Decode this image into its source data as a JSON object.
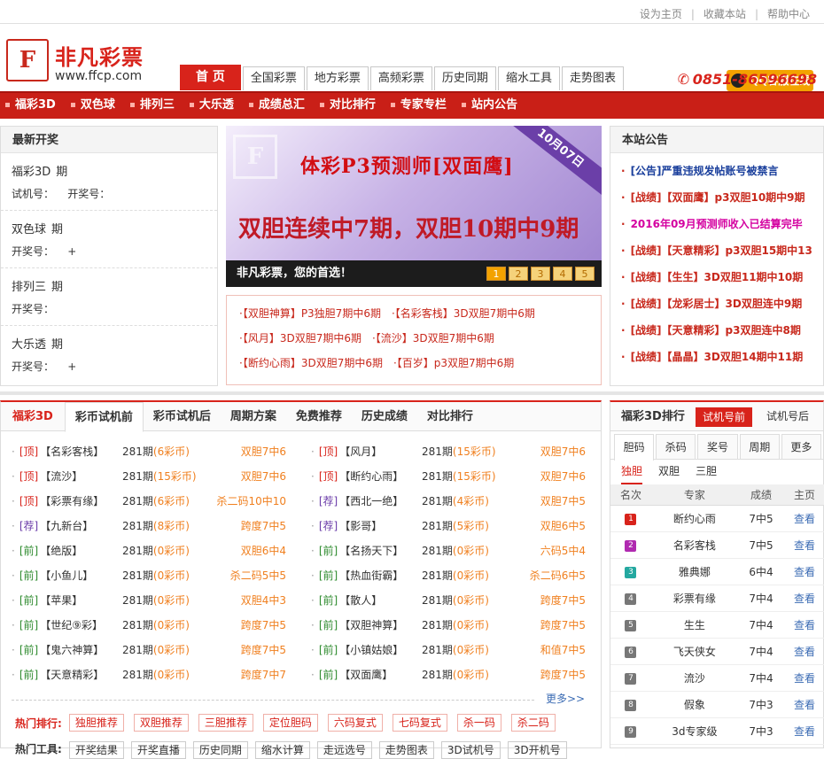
{
  "topbar": {
    "links": [
      "设为主页",
      "收藏本站",
      "帮助中心"
    ]
  },
  "header": {
    "logo_glyph": "F",
    "brand": "非凡彩票",
    "domain": "www.ffcp.com",
    "qq_label": "QQ客服在线",
    "phone": "0851-86596698",
    "tabs": [
      "首 页",
      "全国彩票",
      "地方彩票",
      "高频彩票",
      "历史同期",
      "缩水工具",
      "走势图表"
    ]
  },
  "nav": [
    "福彩3D",
    "双色球",
    "排列三",
    "大乐透",
    "成绩总汇",
    "对比排行",
    "专家专栏",
    "站内公告"
  ],
  "latest": {
    "title": "最新开奖",
    "items": [
      {
        "name": "福彩3D",
        "issue": "期",
        "r1": "试机号：    开奖号：",
        "r2": ""
      },
      {
        "name": "双色球",
        "issue": "期",
        "r1": "开奖号：    +",
        "r2": ""
      },
      {
        "name": "排列三",
        "issue": "期",
        "r1": "开奖号：",
        "r2": ""
      },
      {
        "name": "大乐透",
        "issue": "期",
        "r1": "开奖号：    +",
        "r2": ""
      }
    ]
  },
  "banner": {
    "logo": "F",
    "title": "体彩P3预测师[双面鹰]",
    "subtitle": "双胆连续中7期，双胆10期中9期",
    "corner": "10月07日",
    "caption": "非凡彩票，您的首选！",
    "pages": [
      "1",
      "2",
      "3",
      "4",
      "5"
    ]
  },
  "links": {
    "rows": [
      [
        "·【双胆神算】P3独胆7期中6期",
        "·【名彩客栈】3D双胆7期中6期"
      ],
      [
        "·【风月】3D双胆7期中6期",
        "·【流沙】3D双胆7期中6期"
      ],
      [
        "·【断约心雨】3D双胆7期中6期",
        "·【百岁】p3双胆7期中6期"
      ]
    ]
  },
  "notice": {
    "title": "本站公告",
    "items": [
      {
        "text": "[公告]严重违规发帖账号被禁言",
        "color": "#1a3f9c"
      },
      {
        "text": "[战绩]【双面鹰】p3双胆10期中9期",
        "color": "#c8281c"
      },
      {
        "text": "2016年09月预测师收入已结算完毕",
        "color": "#d400a0"
      },
      {
        "text": "[战绩]【天意精彩】p3双胆15期中13",
        "color": "#c8281c"
      },
      {
        "text": "[战绩]【生生】3D双胆11期中10期",
        "color": "#c8281c"
      },
      {
        "text": "[战绩]【龙彩居士】3D双胆连中9期",
        "color": "#c8281c"
      },
      {
        "text": "[战绩]【天意精彩】p3双胆连中8期",
        "color": "#c8281c"
      },
      {
        "text": "[战绩]【晶晶】3D双胆14期中11期",
        "color": "#c8281c"
      }
    ]
  },
  "main": {
    "tabs": [
      "福彩3D",
      "彩币试机前",
      "彩币试机后",
      "周期方案",
      "免费推荐",
      "历史成绩",
      "对比排行"
    ],
    "left": [
      {
        "tag": "[顶]",
        "name": "【名彩客栈】",
        "issue": "281期",
        "coin": "(6彩币)",
        "res": "双胆7中6"
      },
      {
        "tag": "[顶]",
        "name": "【流沙】",
        "issue": "281期",
        "coin": "(15彩币)",
        "res": "双胆7中6"
      },
      {
        "tag": "[顶]",
        "name": "【彩票有缘】",
        "issue": "281期",
        "coin": "(6彩币)",
        "res": "杀二码10中10"
      },
      {
        "tag": "[荐]",
        "name": "【九新台】",
        "issue": "281期",
        "coin": "(8彩币)",
        "res": "跨度7中5"
      },
      {
        "tag": "[前]",
        "name": "【绝版】",
        "issue": "281期",
        "coin": "(0彩币)",
        "res": "双胆6中4"
      },
      {
        "tag": "[前]",
        "name": "【小鱼儿】",
        "issue": "281期",
        "coin": "(0彩币)",
        "res": "杀二码5中5"
      },
      {
        "tag": "[前]",
        "name": "【苹果】",
        "issue": "281期",
        "coin": "(0彩币)",
        "res": "双胆4中3"
      },
      {
        "tag": "[前]",
        "name": "【世纪⑨彩】",
        "issue": "281期",
        "coin": "(0彩币)",
        "res": "跨度7中5"
      },
      {
        "tag": "[前]",
        "name": "【鬼六神算】",
        "issue": "281期",
        "coin": "(0彩币)",
        "res": "跨度7中5"
      },
      {
        "tag": "[前]",
        "name": "【天意精彩】",
        "issue": "281期",
        "coin": "(0彩币)",
        "res": "跨度7中7"
      }
    ],
    "right": [
      {
        "tag": "[顶]",
        "name": "【风月】",
        "issue": "281期",
        "coin": "(15彩币)",
        "res": "双胆7中6"
      },
      {
        "tag": "[顶]",
        "name": "【断约心雨】",
        "issue": "281期",
        "coin": "(15彩币)",
        "res": "双胆7中6"
      },
      {
        "tag": "[荐]",
        "name": "【西北一绝】",
        "issue": "281期",
        "coin": "(4彩币)",
        "res": "双胆7中5"
      },
      {
        "tag": "[荐]",
        "name": "【影哥】",
        "issue": "281期",
        "coin": "(5彩币)",
        "res": "双胆6中5"
      },
      {
        "tag": "[前]",
        "name": "【名扬天下】",
        "issue": "281期",
        "coin": "(0彩币)",
        "res": "六码5中4"
      },
      {
        "tag": "[前]",
        "name": "【热血街霸】",
        "issue": "281期",
        "coin": "(0彩币)",
        "res": "杀二码6中5"
      },
      {
        "tag": "[前]",
        "name": "【散人】",
        "issue": "281期",
        "coin": "(0彩币)",
        "res": "跨度7中5"
      },
      {
        "tag": "[前]",
        "name": "【双胆神算】",
        "issue": "281期",
        "coin": "(0彩币)",
        "res": "跨度7中5"
      },
      {
        "tag": "[前]",
        "name": "【小镇姑娘】",
        "issue": "281期",
        "coin": "(0彩币)",
        "res": "和值7中5"
      },
      {
        "tag": "[前]",
        "name": "【双面鹰】",
        "issue": "281期",
        "coin": "(0彩币)",
        "res": "跨度7中5"
      }
    ],
    "more": "更多>>",
    "hot_label": "热门排行:",
    "hot": [
      "独胆推荐",
      "双胆推荐",
      "三胆推荐",
      "定位胆码",
      "六码复式",
      "七码复式",
      "杀一码",
      "杀二码"
    ],
    "tools_label": "热门工具:",
    "tools": [
      "开奖结果",
      "开奖直播",
      "历史同期",
      "缩水计算",
      "走远选号",
      "走势图表",
      "3D试机号",
      "3D开机号"
    ]
  },
  "rank": {
    "title": "福彩3D排行",
    "tab1": "试机号前",
    "tab2": "试机号后",
    "tabs": [
      "胆码",
      "杀码",
      "奖号",
      "周期",
      "更多"
    ],
    "subtabs": [
      "独胆",
      "双胆",
      "三胆"
    ],
    "cols": [
      "名次",
      "专家",
      "成绩",
      "主页"
    ],
    "rows": [
      {
        "rank": "1",
        "name": "断约心雨",
        "score": "7中5",
        "link": "查看",
        "color": "#d8231b"
      },
      {
        "rank": "2",
        "name": "名彩客栈",
        "score": "7中5",
        "link": "查看",
        "color": "#b02ab0"
      },
      {
        "rank": "3",
        "name": "雅典娜",
        "score": "6中4",
        "link": "查看",
        "color": "#24a8a0"
      },
      {
        "rank": "4",
        "name": "彩票有缘",
        "score": "7中4",
        "link": "查看",
        "color": "#777"
      },
      {
        "rank": "5",
        "name": "生生",
        "score": "7中4",
        "link": "查看",
        "color": "#777"
      },
      {
        "rank": "6",
        "name": "飞天侠女",
        "score": "7中4",
        "link": "查看",
        "color": "#777"
      },
      {
        "rank": "7",
        "name": "流沙",
        "score": "7中4",
        "link": "查看",
        "color": "#777"
      },
      {
        "rank": "8",
        "name": "假象",
        "score": "7中3",
        "link": "查看",
        "color": "#777"
      },
      {
        "rank": "9",
        "name": "3d专家级",
        "score": "7中3",
        "link": "查看",
        "color": "#777"
      }
    ]
  }
}
